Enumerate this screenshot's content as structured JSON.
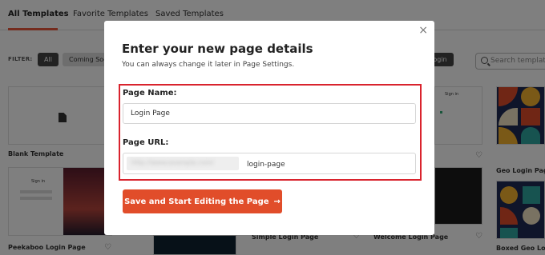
{
  "tabs": [
    "All Templates",
    "Favorite Templates",
    "Saved Templates"
  ],
  "filter": {
    "label": "FILTER:",
    "chips": [
      "All",
      "Coming Soon",
      "Login"
    ]
  },
  "search": {
    "placeholder": "Search templates"
  },
  "cards": {
    "blank": "Blank Template",
    "peekaboo": "Peekaboo Login Page",
    "simple": "Simple Login Page",
    "welcome": "Welcome Login Page",
    "geo": "Geo Login Page",
    "boxed_geo": "Boxed Geo Login",
    "sign_in": "Sign in"
  },
  "modal": {
    "close_icon": "×",
    "title": "Enter your new page details",
    "subtitle": "You can always change it later in Page Settings.",
    "page_name_label": "Page Name:",
    "page_name_value": "Login Page",
    "page_url_label": "Page URL:",
    "url_prefix_blurred": "http://www.example.com/",
    "url_slug": "login-page",
    "cta_label": "Save and Start Editing the Page",
    "cta_arrow": "→"
  },
  "colors": {
    "accent": "#e14d2a",
    "highlight": "#d9232d",
    "tab_underline": "#e8563b"
  }
}
